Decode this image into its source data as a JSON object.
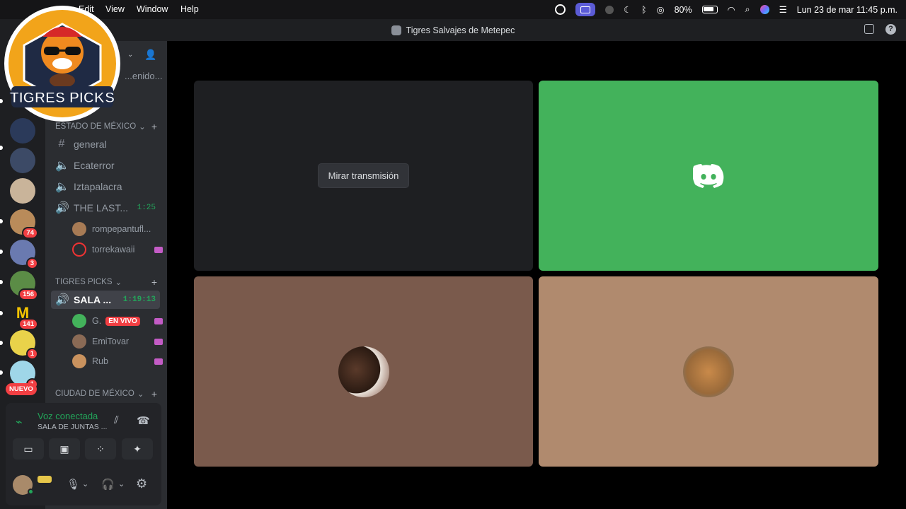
{
  "menubar": {
    "menus": [
      "Edit",
      "View",
      "Window",
      "Help"
    ],
    "battery": "80%",
    "datetime": "Lun 23 de mar  11:45 p.m."
  },
  "window": {
    "title": "Tigres Salvajes de Metepec"
  },
  "logo": {
    "text": "TIGRES PICKS"
  },
  "rail": {
    "badges": [
      "74",
      "3",
      "156",
      "141",
      "1",
      "1"
    ],
    "nuevo": "NUEVO"
  },
  "sidebar": {
    "partial_top": "...enido...",
    "categories": {
      "edomex": "ESTADO DE MÉXICO",
      "tigres": "TIGRES PICKS",
      "cdmx": "CIUDAD DE MÉXICO"
    },
    "channels": [
      {
        "name": "general",
        "icon": "#"
      },
      {
        "name": "Ecaterror",
        "icon": "speaker"
      },
      {
        "name": "Iztapalacra",
        "icon": "speaker"
      },
      {
        "name": "THE LAST...",
        "icon": "speaker",
        "time": "1:25"
      }
    ],
    "voice_users_1": [
      "rompepantufl...",
      "torrekawaii"
    ],
    "active_channel": {
      "name": "SALA ...",
      "time": "1:19:13"
    },
    "voice_users_2": [
      {
        "name": "G.",
        "live": "EN VIVO"
      },
      {
        "name": "EmiTovar"
      },
      {
        "name": "Rub"
      }
    ]
  },
  "voicepanel": {
    "status": "Voz conectada",
    "channel": "SALA DE JUNTAS ..."
  },
  "stage": {
    "watch_button": "Mirar transmisión"
  },
  "colors": {
    "discord_green": "#43b25b",
    "tile_dark": "#1e1f22",
    "tile_brown": "#7a5a4c",
    "tile_tan": "#b08a6e"
  }
}
